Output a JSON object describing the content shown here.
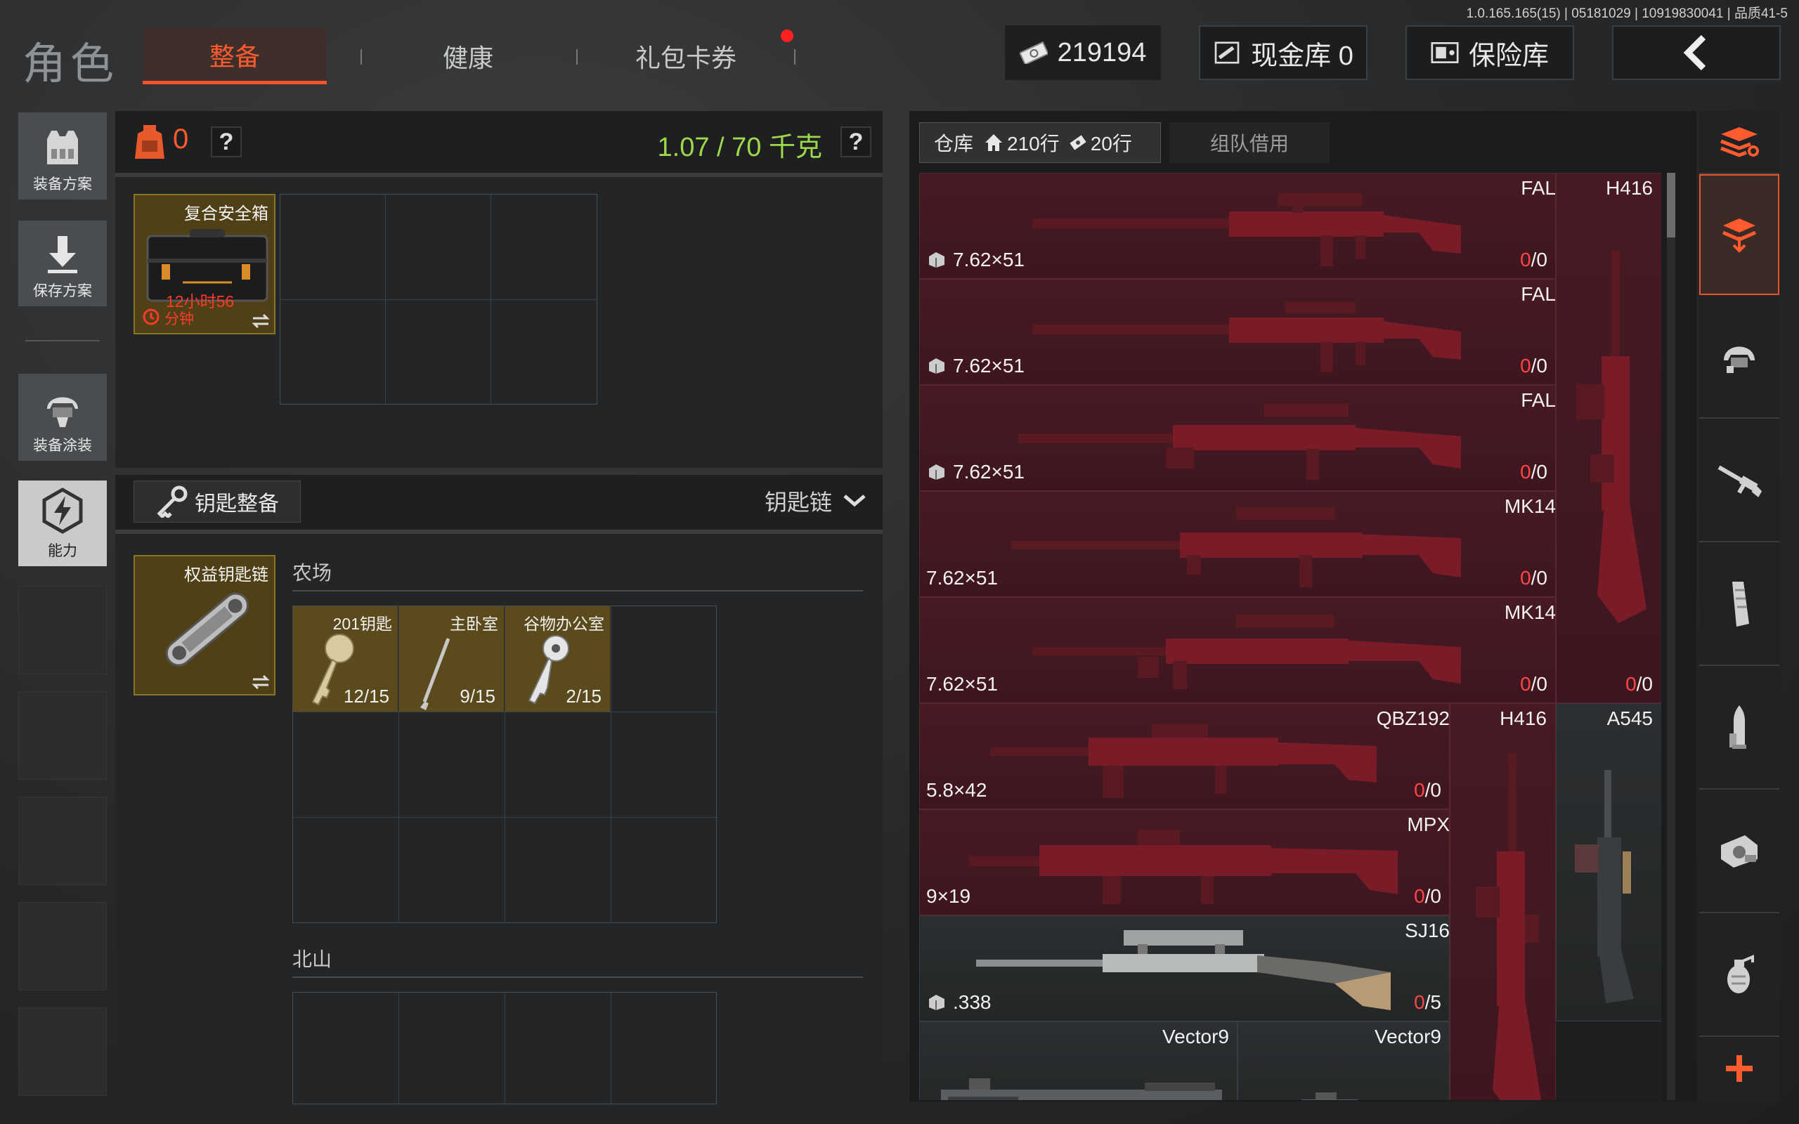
{
  "version": "1.0.165.165(15) | 05181029 | 10919830041 | 品质41-5",
  "title": "角色",
  "tabs": [
    "整备",
    "健康",
    "礼包卡券"
  ],
  "currency": {
    "amount": "219194"
  },
  "cash_vault": "现金库 0",
  "safe_vault": "保险库",
  "left_menu": {
    "loadout": "装备方案",
    "save": "保存方案",
    "skin": "装备涂装",
    "ability": "能力"
  },
  "gear": {
    "count": "0",
    "weight": "1.07 / 70 千克",
    "help": "?",
    "safe_box": {
      "name": "复合安全箱",
      "timer": "12小时56",
      "timer_unit": "分钟"
    }
  },
  "keys": {
    "header": "钥匙整备",
    "dropdown": "钥匙链",
    "keychain": "权益钥匙链",
    "section1": "农场",
    "items": [
      {
        "name": "201钥匙",
        "count": "12/15"
      },
      {
        "name": "主卧室",
        "count": "9/15"
      },
      {
        "name": "谷物办公室",
        "count": "2/15"
      }
    ],
    "section2": "北山"
  },
  "warehouse": {
    "tab": "仓库",
    "rows1": "210行",
    "rows2": "20行",
    "borrow_tab": "组队借用",
    "items": [
      {
        "name": "FAL",
        "caliber": "7.62×51",
        "count_zero": "0",
        "count_rest": "/0"
      },
      {
        "name": "FAL",
        "caliber": "7.62×51",
        "count_zero": "0",
        "count_rest": "/0"
      },
      {
        "name": "FAL",
        "caliber": "7.62×51",
        "count_zero": "0",
        "count_rest": "/0"
      },
      {
        "name": "MK14",
        "caliber": "7.62×51",
        "count_zero": "0",
        "count_rest": "/0"
      },
      {
        "name": "MK14",
        "caliber": "7.62×51",
        "count_zero": "0",
        "count_rest": "/0"
      },
      {
        "name": "QBZ192",
        "caliber": "5.8×42",
        "count_zero": "0",
        "count_rest": "/0"
      },
      {
        "name": "MPX",
        "caliber": "9×19",
        "count_zero": "0",
        "count_rest": "/0"
      },
      {
        "name": "SJ16",
        "caliber": ".338",
        "count_zero": "0",
        "count_rest": "/5"
      },
      {
        "name": "Vector9"
      },
      {
        "name": "Vector9"
      }
    ],
    "tall_items": [
      {
        "name": "H416",
        "count_zero": "0",
        "count_rest": "/0"
      },
      {
        "name": "H416"
      },
      {
        "name": "A545"
      }
    ]
  }
}
